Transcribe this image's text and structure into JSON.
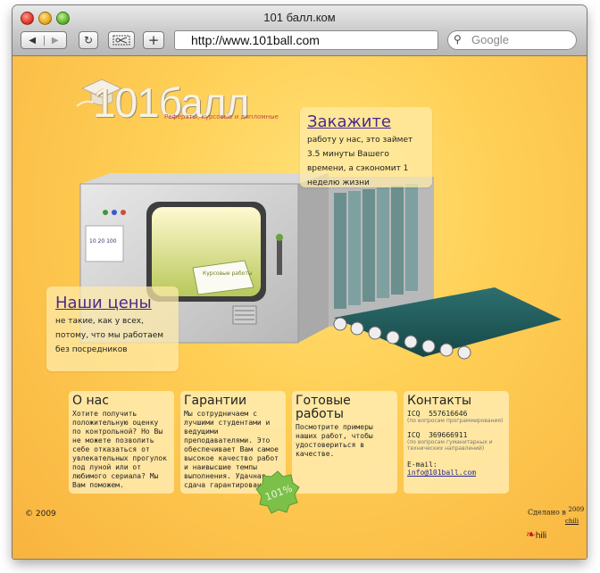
{
  "window": {
    "title": "101 балл.ком"
  },
  "toolbar": {
    "back_glyph": "◀",
    "forward_glyph": "▶",
    "reload_glyph": "↻",
    "add_glyph": "+",
    "url": "http://www.101ball.com",
    "search_placeholder": "Google"
  },
  "header": {
    "logo": "101балл",
    "tagline": "Рефераты, курсовые и дипломные"
  },
  "order_bubble": {
    "title": "Закажите",
    "text": "работу у нас, это займет 3.5 минуты Вашего времени, а сэкономит 1 неделю жизни"
  },
  "prices_bubble": {
    "title": "Наши цены",
    "text": "не такие, как у всех, потому, что мы работаем без посредников"
  },
  "cards": [
    {
      "title": "О нас",
      "text": "Хотите получить положительную оценку по контрольной? Но Вы не можете позволить себе отказаться от увлекательных прогулок под луной или от любимого сериала? Мы Вам поможем."
    },
    {
      "title": "Гарантии",
      "text": "Мы сотрудничаем с лучшими студентами и ведущими преподавателями. Это обеспечивает Вам самое высокое качество работ и наивысшие темпы выполнения. Удачная сдача гарантирована!"
    },
    {
      "title": "Готовые работы",
      "text": "Посмотрите примеры наших работ, чтобы удостовериться в качестве."
    }
  ],
  "contacts": {
    "title": "Контакты",
    "icq1_label": "ICQ",
    "icq1_number": "557616646",
    "icq1_note": "(по вопросам программирования)",
    "icq2_label": "ICQ",
    "icq2_number": "369666911",
    "icq2_note": "(по вопросам гуманитарных и технических направлений)",
    "email_label": "E-mail:",
    "email": "info@101ball.com"
  },
  "footer": {
    "copyright": "© 2009",
    "made_in": "Сделано в",
    "made_year": "2009",
    "made_by": "chili",
    "brand": "hili"
  },
  "seal_text": "101%",
  "machine_screen_text": "Курсовые работы",
  "machine_panel_text": "10 20 100",
  "colors": {
    "page_bg": "#ffcf55",
    "link": "#4b2a8a",
    "card_bg": "#fff0be"
  }
}
